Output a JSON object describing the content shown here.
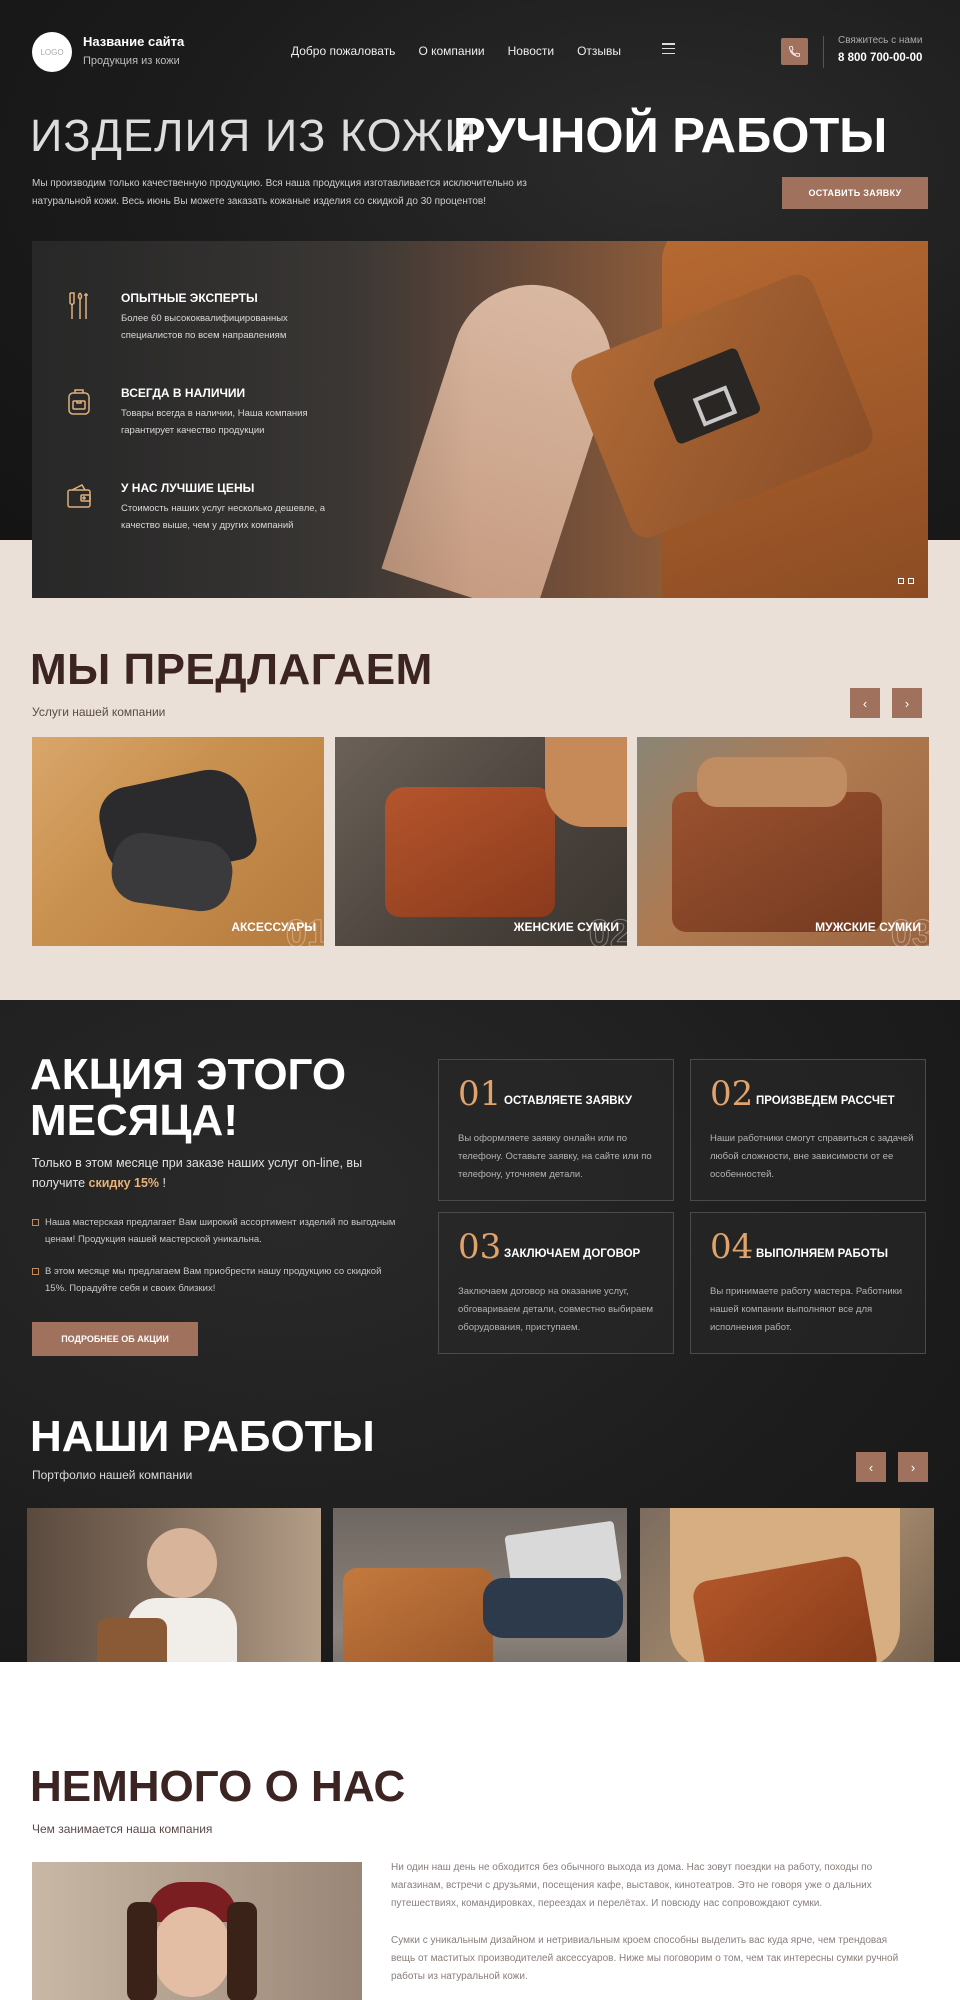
{
  "header": {
    "logo_text": "LOGO",
    "site_name": "Название сайта",
    "site_sub": "Продукция из кожи",
    "nav": [
      "Добро пожаловать",
      "О компании",
      "Новости",
      "Отзывы"
    ],
    "contact_label": "Свяжитесь с нами",
    "contact_phone": "8 800 700-00-00"
  },
  "hero": {
    "title_light": "ИЗДЕЛИЯ ИЗ КОЖИ",
    "title_bold": "РУЧНОЙ РАБОТЫ",
    "desc": "Мы производим только качественную продукцию. Вся наша продукция изготавливается исключительно из натуральной кожи. Весь июнь Вы можете  заказать кожаные изделия со скидкой до 30 процентов!",
    "cta": "ОСТАВИТЬ ЗАЯВКУ",
    "features": [
      {
        "title": "ОПЫТНЫЕ ЭКСПЕРТЫ",
        "desc": "Более 60 высококвалифицированных специалистов по всем направлениям",
        "icon": "tools-icon"
      },
      {
        "title": "ВСЕГДА В НАЛИЧИИ",
        "desc": "Товары всегда в наличии, Наша компания гарантирует качество продукции",
        "icon": "backpack-icon"
      },
      {
        "title": "У НАС ЛУЧШИЕ ЦЕНЫ",
        "desc": "Стоимость наших услуг несколько дешевле, а качество выше, чем у других компаний",
        "icon": "wallet-icon"
      }
    ]
  },
  "offer": {
    "title": "МЫ ПРЕДЛАГАЕМ",
    "sub": "Услуги нашей компании",
    "cards": [
      {
        "label": "АКСЕССУАРЫ",
        "num": "01"
      },
      {
        "label": "ЖЕНСКИЕ СУМКИ",
        "num": "02"
      },
      {
        "label": "МУЖСКИЕ СУМКИ",
        "num": "03"
      }
    ]
  },
  "promo": {
    "title_line1": "АКЦИЯ ЭТОГО",
    "title_line2": "МЕСЯЦА!",
    "text_before": "Только в этом месяце при заказе наших услуг on-line, вы получите ",
    "text_highlight": "скидку 15%",
    "text_after": " !",
    "bullets": [
      "Наша мастерская предлагает Вам широкий ассортимент изделий по выгодным ценам! Продукция нашей мастерской уникальна.",
      "В этом месяце мы предлагаем Вам приобрести нашу продукцию со скидкой 15%. Порадуйте себя и своих близких!"
    ],
    "button": "ПОДРОБНЕЕ ОБ АКЦИИ",
    "steps": [
      {
        "num": "01",
        "title": "ОСТАВЛЯЕТЕ ЗАЯВКУ",
        "desc": "Вы оформляете заявку онлайн или по телефону. Оставьте заявку, на сайте или по телефону, уточняем детали."
      },
      {
        "num": "02",
        "title": "ПРОИЗВЕДЕМ РАССЧЕТ",
        "desc": "Наши работники смогут справиться с задачей любой сложности, вне зависимости от ее особенностей."
      },
      {
        "num": "03",
        "title": "ЗАКЛЮЧАЕМ ДОГОВОР",
        "desc": "Заключаем договор на оказание услуг, обговариваем детали, совместно выбираем оборудования, приступаем."
      },
      {
        "num": "04",
        "title": "ВЫПОЛНЯЕМ РАБОТЫ",
        "desc": "Вы принимаете работу мастера. Работники нашей компании выполняют все  для исполнения работ."
      }
    ]
  },
  "works": {
    "title": "НАШИ РАБОТЫ",
    "sub": "Портфолио нашей компании"
  },
  "about": {
    "title": "НЕМНОГО О НАС",
    "sub": "Чем занимается наша компания",
    "p1": "Ни один наш день не обходится без обычного выхода из дома. Нас зовут поездки на работу, походы по магазинам, встречи с друзьями, посещения кафе, выставок, кинотеатров. Это не говоря уже о дальних путешествиях, командировках, переездах и перелётах. И повсюду нас сопровождают сумки.",
    "p2": "Сумки с уникальным дизайном и нетривиальным кроем способны выделить вас куда ярче, чем трендовая вещь от маститых производителей аксессуаров. Ниже мы поговорим о том, чем так интересны сумки ручной работы из натуральной кожи."
  },
  "colors": {
    "accent": "#a0715c",
    "dark": "#1c1c1c",
    "cream": "#ebe0d7",
    "highlight": "#e6b17a"
  }
}
